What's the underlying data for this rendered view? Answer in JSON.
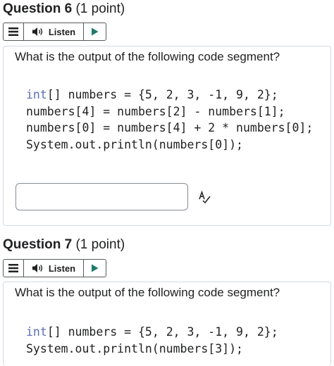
{
  "questions": [
    {
      "number": "Question 6",
      "points": "(1 point)",
      "listen_label": "Listen",
      "prompt": "What is the output of the following code segment?",
      "code": {
        "line1_kw": "int",
        "line1_rest": "[] numbers = {5, 2, 3, -1, 9, 2};",
        "line2": "numbers[4] = numbers[2] - numbers[1];",
        "line3": "numbers[0] = numbers[4] + 2 * numbers[0];",
        "line4": "System.out.println(numbers[0]);"
      },
      "answer_value": ""
    },
    {
      "number": "Question 7",
      "points": "(1 point)",
      "listen_label": "Listen",
      "prompt": "What is the output of the following code segment?",
      "code": {
        "line1_kw": "int",
        "line1_rest": "[] numbers = {5, 2, 3, -1, 9, 2};",
        "line2": "System.out.println(numbers[3]);"
      }
    }
  ],
  "icons": {
    "menu": "hamburger-menu-icon",
    "speaker": "speaker-icon",
    "play": "play-icon",
    "spellcheck": "spellcheck-icon"
  },
  "colors": {
    "keyword": "#5a6db5",
    "text": "#202122",
    "border": "#d3d9e3"
  }
}
